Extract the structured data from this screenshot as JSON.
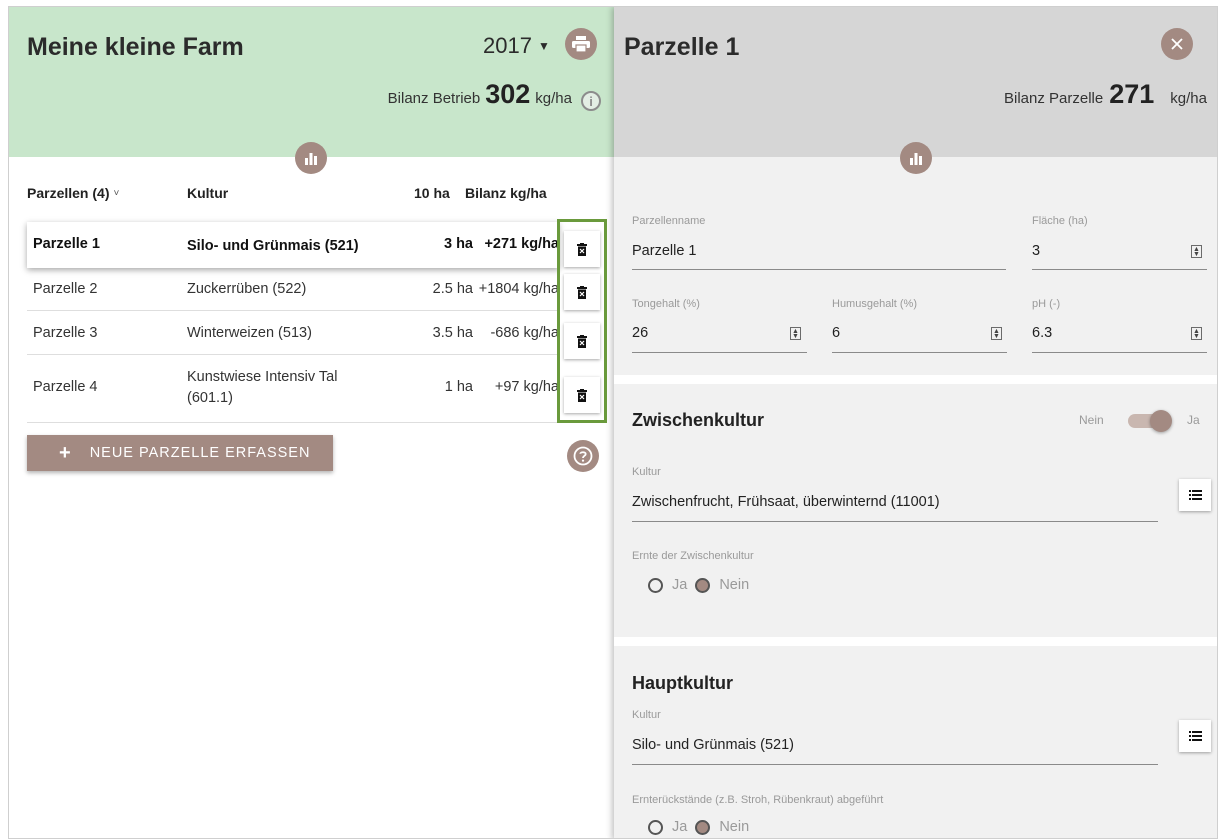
{
  "farm": {
    "title": "Meine kleine Farm",
    "year": "2017",
    "bilanz_label": "Bilanz Betrieb",
    "bilanz_value": "302",
    "bilanz_unit": "kg/ha"
  },
  "table": {
    "headers": {
      "parzellen": "Parzellen (4)",
      "kultur": "Kultur",
      "ha": "10 ha",
      "bilanz": "Bilanz kg/ha"
    },
    "rows": [
      {
        "name": "Parzelle 1",
        "kultur": "Silo- und Grünmais (521)",
        "ha": "3  ha",
        "bilanz": "+271 kg/ha"
      },
      {
        "name": "Parzelle 2",
        "kultur": "Zuckerrüben (522)",
        "ha": "2.5  ha",
        "bilanz": "+1804 kg/ha"
      },
      {
        "name": "Parzelle 3",
        "kultur": "Winterweizen (513)",
        "ha": "3.5  ha",
        "bilanz": "-686 kg/ha"
      },
      {
        "name": "Parzelle 4",
        "kultur": "Kunstwiese Intensiv Tal (601.1)",
        "ha": "1  ha",
        "bilanz": "+97 kg/ha"
      }
    ],
    "new_button": "NEUE PARZELLE ERFASSEN"
  },
  "detail": {
    "title": "Parzelle 1",
    "bilanz_label": "Bilanz Parzelle",
    "bilanz_value": "271",
    "bilanz_unit": "kg/ha",
    "fields": {
      "name_label": "Parzellenname",
      "name_value": "Parzelle 1",
      "flaeche_label": "Fläche (ha)",
      "flaeche_value": "3",
      "ton_label": "Tongehalt (%)",
      "ton_value": "26",
      "humus_label": "Humusgehalt (%)",
      "humus_value": "6",
      "ph_label": "pH (-)",
      "ph_value": "6.3"
    },
    "zwischenkultur": {
      "title": "Zwischenkultur",
      "toggle_off": "Nein",
      "toggle_on": "Ja",
      "kultur_label": "Kultur",
      "kultur_value": "Zwischenfrucht, Frühsaat, überwinternd (11001)",
      "ernte_label": "Ernte der Zwischenkultur",
      "radio_ja": "Ja",
      "radio_nein": "Nein"
    },
    "hauptkultur": {
      "title": "Hauptkultur",
      "kultur_label": "Kultur",
      "kultur_value": "Silo- und Grünmais (521)",
      "ernte_label": "Ernterückstände (z.B. Stroh, Rübenkraut) abgeführt",
      "radio_ja": "Ja",
      "radio_nein": "Nein"
    }
  },
  "colors": {
    "accent": "#a38a82",
    "header_green": "#c8e6cb",
    "header_grey": "#d6d6d6",
    "highlight_border": "#6a9a3c"
  }
}
